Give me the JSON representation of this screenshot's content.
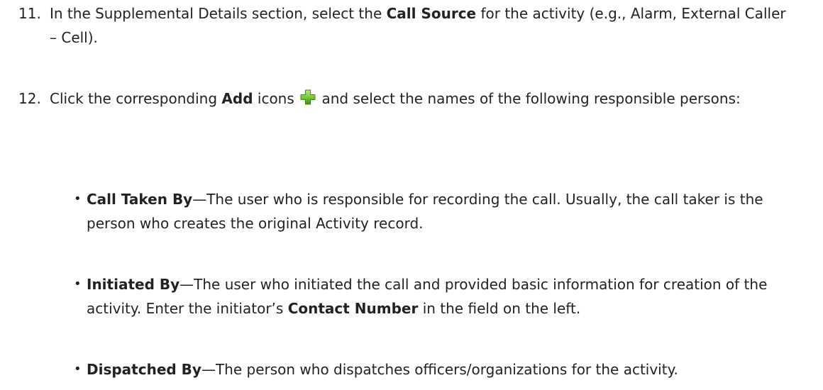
{
  "steps": [
    {
      "number": "11.",
      "parts": [
        "In the Supplemental Details section, select the ",
        "Call Source",
        " for the activity (e.g., Alarm, External Caller – Cell)."
      ]
    },
    {
      "number": "12.",
      "parts": [
        "Click the corresponding ",
        "Add",
        " icons ",
        " and select the names of the following responsible persons:"
      ],
      "icon": "green-plus-add-icon"
    }
  ],
  "bullets": [
    {
      "symbol": "•",
      "term": "Call Taken By",
      "text": "—The user who is responsible for recording the call. Usually, the call taker is the person who creates the original Activity record."
    },
    {
      "symbol": "•",
      "term": "Initiated By",
      "text_before": "—The user who initiated the call and provided basic information for creation of the activity. Enter the initiator’s ",
      "bold_inline": "Contact Number",
      "text_after": " in the field on the left."
    },
    {
      "symbol": "•",
      "term": "Dispatched By",
      "text": "—The person who dispatches officers/organizations for the activity."
    }
  ],
  "colors": {
    "text": "#222222",
    "icon_green_light": "#8fd14f",
    "icon_green_dark": "#3e8e1c"
  }
}
